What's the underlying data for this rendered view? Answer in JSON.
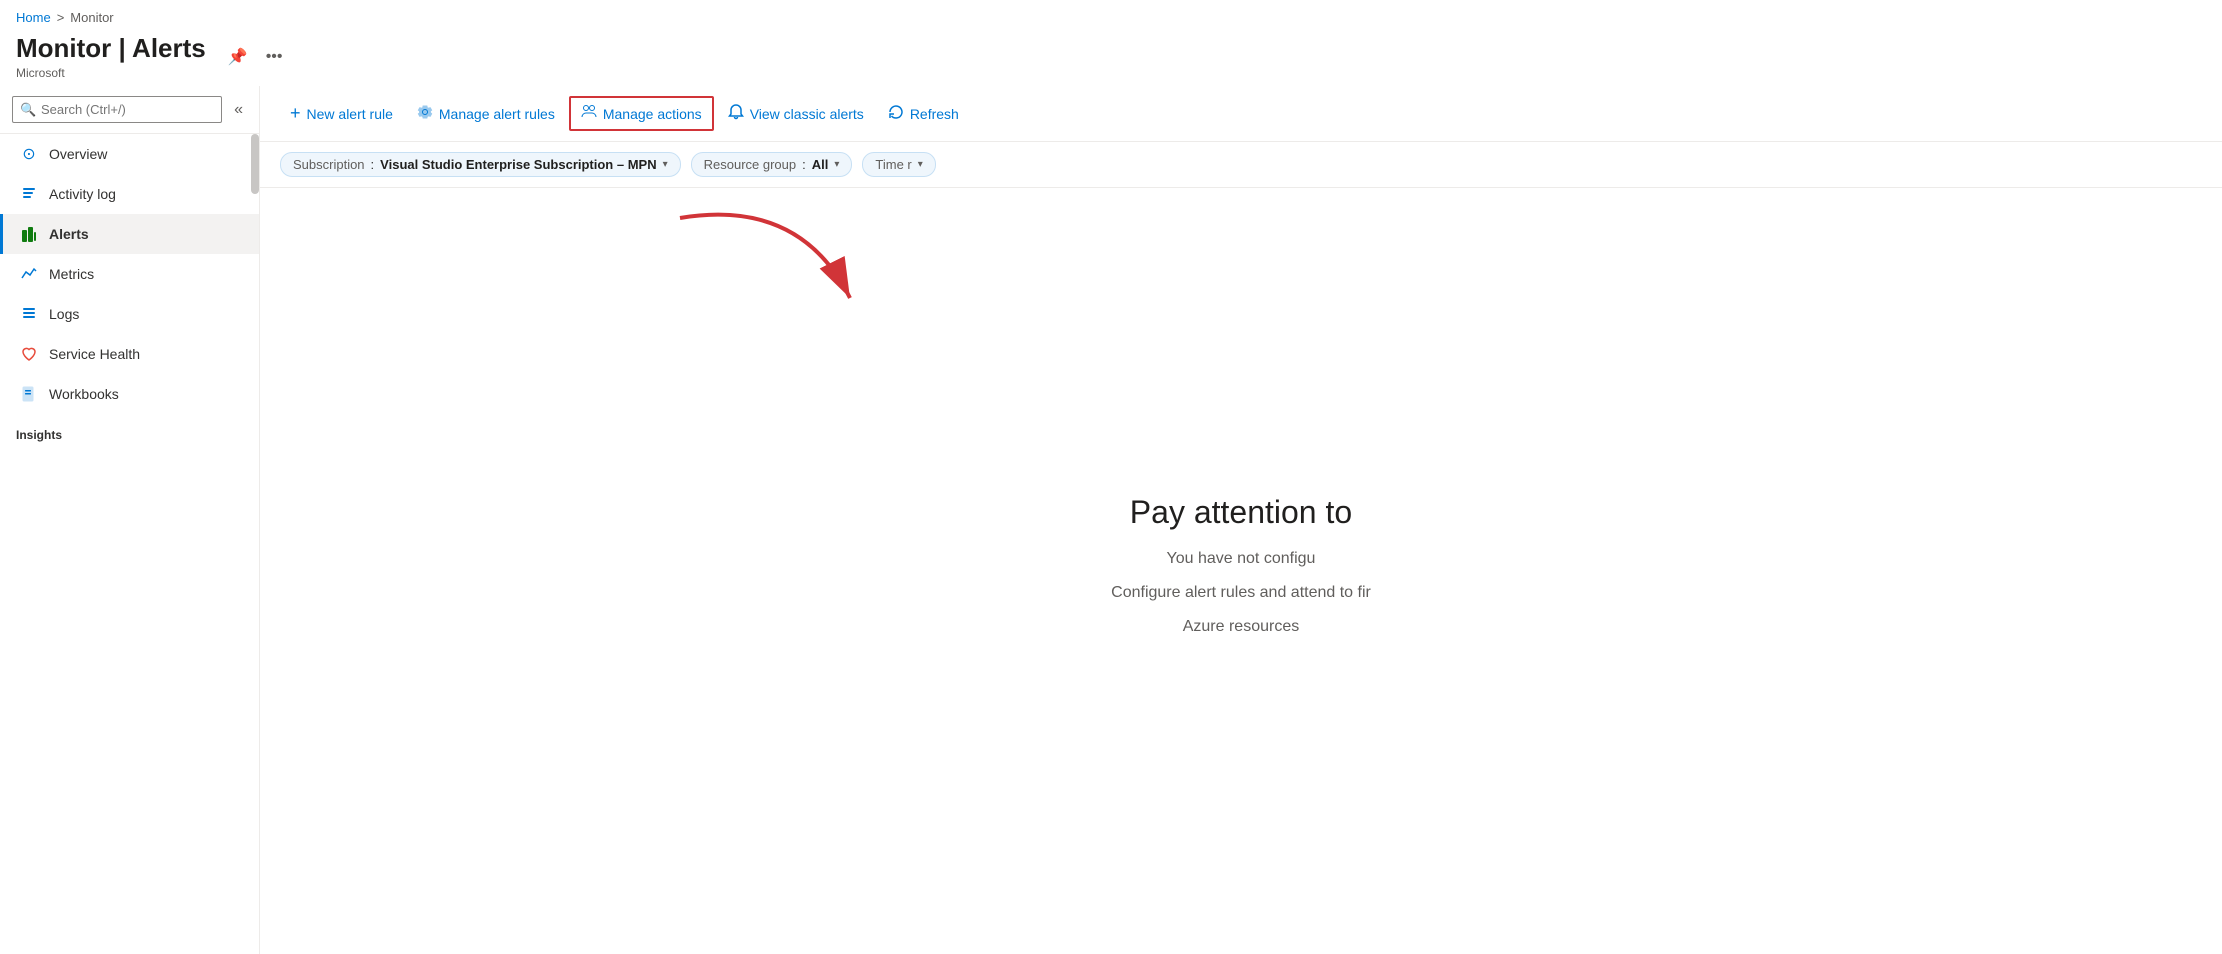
{
  "breadcrumb": {
    "home": "Home",
    "separator": ">",
    "current": "Monitor"
  },
  "header": {
    "title": "Monitor | Alerts",
    "subtitle": "Microsoft",
    "pin_label": "📌",
    "more_label": "..."
  },
  "sidebar": {
    "search_placeholder": "Search (Ctrl+/)",
    "collapse_icon": "«",
    "nav_items": [
      {
        "id": "overview",
        "label": "Overview",
        "icon": "⊙",
        "active": false
      },
      {
        "id": "activity-log",
        "label": "Activity log",
        "icon": "📋",
        "active": false
      },
      {
        "id": "alerts",
        "label": "Alerts",
        "icon": "📊",
        "active": true
      },
      {
        "id": "metrics",
        "label": "Metrics",
        "icon": "📈",
        "active": false
      },
      {
        "id": "logs",
        "label": "Logs",
        "icon": "🗃",
        "active": false
      },
      {
        "id": "service-health",
        "label": "Service Health",
        "icon": "♡",
        "active": false
      },
      {
        "id": "workbooks",
        "label": "Workbooks",
        "icon": "📘",
        "active": false
      }
    ],
    "section_label": "Insights"
  },
  "toolbar": {
    "new_alert_rule": "New alert rule",
    "manage_alert_rules": "Manage alert rules",
    "manage_actions": "Manage actions",
    "view_classic_alerts": "View classic alerts",
    "refresh": "Refresh"
  },
  "filters": {
    "subscription_label": "Subscription",
    "subscription_value": "Visual Studio Enterprise Subscription – MPN",
    "resource_group_label": "Resource group",
    "resource_group_value": "All",
    "time_label": "Time r"
  },
  "empty_state": {
    "title": "Pay attention to",
    "line1": "You have not configu",
    "line2": "Configure alert rules and attend to fir",
    "line3": "Azure resources"
  }
}
